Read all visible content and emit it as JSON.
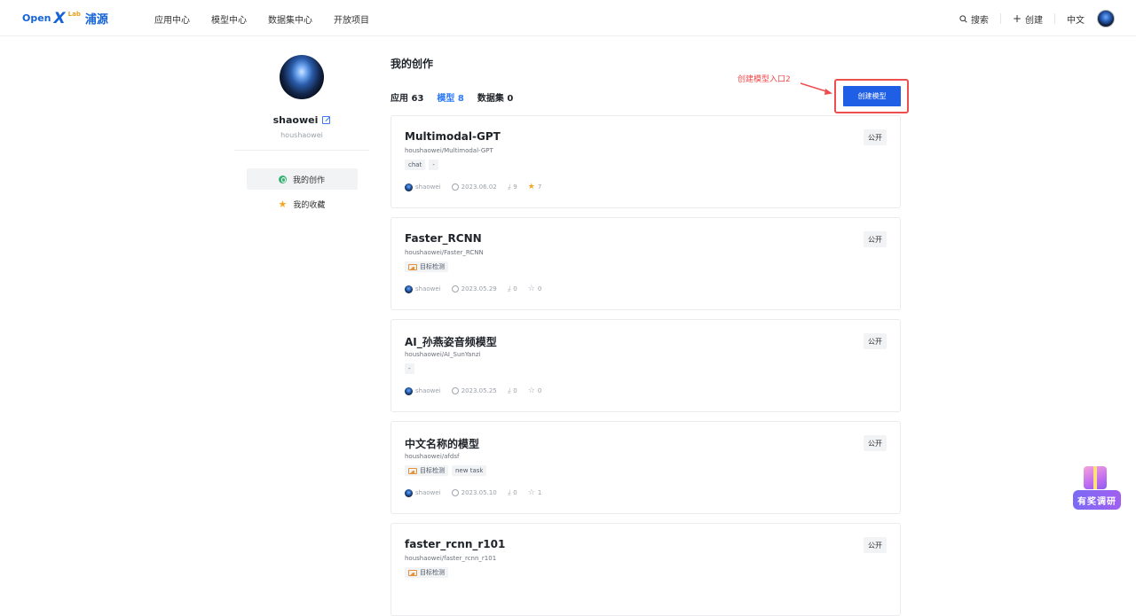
{
  "header": {
    "logo_open": "Open",
    "logo_x": "X",
    "logo_lab": "Lab",
    "logo_cn": "浦源",
    "nav": [
      "应用中心",
      "模型中心",
      "数据集中心",
      "开放项目"
    ],
    "search_label": "搜索",
    "create_label": "创建",
    "lang_label": "中文"
  },
  "profile": {
    "display_name": "shaowei",
    "handle": "houshaowei",
    "menu": [
      "我的创作",
      "我的收藏"
    ]
  },
  "main": {
    "title": "我的创作",
    "tabs": [
      {
        "label": "应用",
        "count": "63"
      },
      {
        "label": "模型",
        "count": "8"
      },
      {
        "label": "数据集",
        "count": "0"
      }
    ],
    "annotation": "创建模型入口2",
    "create_button": "创建模型"
  },
  "models": [
    {
      "name": "Multimodal-GPT",
      "path": "houshaowei/Multimodal-GPT",
      "tags": [
        "chat",
        "-"
      ],
      "image_tag": false,
      "author": "shaowei",
      "date": "2023.06.02",
      "downloads": "9",
      "stars": "7",
      "starred": true,
      "visibility": "公开"
    },
    {
      "name": "Faster_RCNN",
      "path": "houshaowei/Faster_RCNN",
      "tags": [
        "目标检测"
      ],
      "image_tag": true,
      "author": "shaowei",
      "date": "2023.05.29",
      "downloads": "0",
      "stars": "0",
      "starred": false,
      "visibility": "公开"
    },
    {
      "name": "AI_孙燕姿音频模型",
      "path": "houshaowei/AI_SunYanzi",
      "tags": [
        "-"
      ],
      "image_tag": false,
      "author": "shaowei",
      "date": "2023.05.25",
      "downloads": "0",
      "stars": "0",
      "starred": false,
      "visibility": "公开"
    },
    {
      "name": "中文名称的模型",
      "path": "houshaowei/afdsf",
      "tags": [
        "目标检测",
        "new task"
      ],
      "image_tag": true,
      "author": "shaowei",
      "date": "2023.05.10",
      "downloads": "0",
      "stars": "1",
      "starred": false,
      "visibility": "公开"
    },
    {
      "name": "faster_rcnn_r101",
      "path": "houshaowei/faster_rcnn_r101",
      "tags": [
        "目标检测"
      ],
      "image_tag": true,
      "author": "",
      "date": "",
      "downloads": "",
      "stars": "",
      "starred": false,
      "visibility": "公开"
    }
  ],
  "survey_widget": {
    "label": "有奖调研"
  }
}
